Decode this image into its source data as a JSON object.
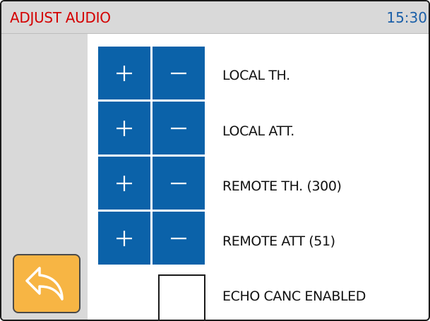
{
  "header": {
    "title": "ADJUST AUDIO",
    "time": "15:30"
  },
  "rows": [
    {
      "label": "LOCAL TH.",
      "plus_icon": "plus-icon",
      "minus_icon": "minus-icon"
    },
    {
      "label": "LOCAL ATT.",
      "plus_icon": "plus-icon",
      "minus_icon": "minus-icon"
    },
    {
      "label": "REMOTE TH. (300)",
      "plus_icon": "plus-icon",
      "minus_icon": "minus-icon"
    },
    {
      "label": "REMOTE ATT (51)",
      "plus_icon": "plus-icon",
      "minus_icon": "minus-icon"
    }
  ],
  "echo": {
    "label": "ECHO CANC ENABLED",
    "checked": false
  },
  "back": {
    "icon": "back-arrow-icon"
  },
  "colors": {
    "button_blue": "#0b62a9",
    "header_gray": "#d9d9d9",
    "title_red": "#d40000",
    "clock_blue": "#1a5fa8",
    "back_orange": "#f7b544"
  }
}
